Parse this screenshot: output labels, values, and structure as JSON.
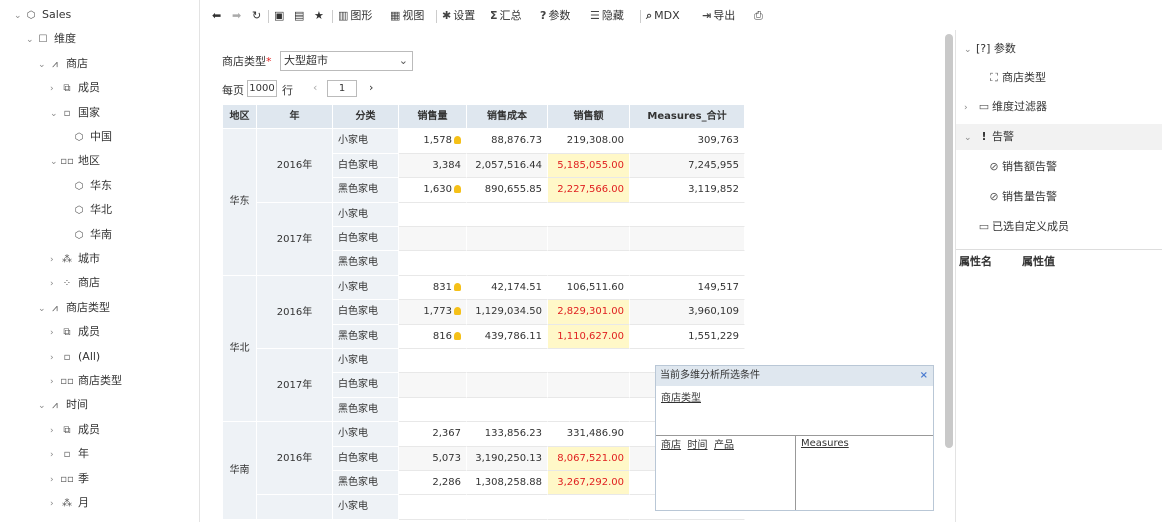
{
  "tree": {
    "root": "Sales",
    "items": [
      {
        "label": "Sales",
        "icon": "cube",
        "arrow": "v"
      },
      {
        "label": "维度",
        "icon": "dimension",
        "arrow": "v"
      },
      {
        "label": "商店",
        "icon": "hierarchy",
        "arrow": "v"
      },
      {
        "label": "成员",
        "icon": "member",
        "arrow": ">"
      },
      {
        "label": "国家",
        "icon": "level1",
        "arrow": "v"
      },
      {
        "label": "中国",
        "icon": "cube",
        "arrow": ""
      },
      {
        "label": "地区",
        "icon": "level2",
        "arrow": "v"
      },
      {
        "label": "华东",
        "icon": "cube",
        "arrow": ""
      },
      {
        "label": "华北",
        "icon": "cube",
        "arrow": ""
      },
      {
        "label": "华南",
        "icon": "cube",
        "arrow": ""
      },
      {
        "label": "城市",
        "icon": "level3",
        "arrow": ">"
      },
      {
        "label": "商店",
        "icon": "level4",
        "arrow": ">"
      },
      {
        "label": "商店类型",
        "icon": "hierarchy",
        "arrow": "v"
      },
      {
        "label": "成员",
        "icon": "member",
        "arrow": ">"
      },
      {
        "label": "(All)",
        "icon": "level1",
        "arrow": ">"
      },
      {
        "label": "商店类型",
        "icon": "level2",
        "arrow": ">"
      },
      {
        "label": "时间",
        "icon": "hierarchy",
        "arrow": "v"
      },
      {
        "label": "成员",
        "icon": "member",
        "arrow": ">"
      },
      {
        "label": "年",
        "icon": "level1",
        "arrow": ">"
      },
      {
        "label": "季",
        "icon": "level2",
        "arrow": ">"
      },
      {
        "label": "月",
        "icon": "level3",
        "arrow": ">"
      }
    ]
  },
  "toolbar": {
    "chart": "图形",
    "view": "视图",
    "settings": "设置",
    "summary": "汇总",
    "params": "参数",
    "hide": "隐藏",
    "mdx": "MDX",
    "export": "导出"
  },
  "filter": {
    "label": "商店类型",
    "required": "*",
    "value": "大型超市"
  },
  "paging": {
    "per_page_label": "每页",
    "per_page": "1000",
    "rows_label": "行",
    "page": "1"
  },
  "grid": {
    "headers": [
      "地区",
      "年",
      "分类",
      "销售量",
      "销售成本",
      "销售额",
      "Measures_合计"
    ],
    "sort_indicator": "▼",
    "regions": [
      {
        "name": "华东",
        "years": [
          {
            "year": "2016年",
            "rows": [
              {
                "cat": "小家电",
                "qty": "1,578",
                "bulb": true,
                "cost": "88,876.73",
                "sales": "219,308.00",
                "hl": false,
                "total": "309,763"
              },
              {
                "cat": "白色家电",
                "qty": "3,384",
                "bulb": false,
                "cost": "2,057,516.44",
                "sales": "5,185,055.00",
                "hl": true,
                "total": "7,245,955"
              },
              {
                "cat": "黑色家电",
                "qty": "1,630",
                "bulb": true,
                "cost": "890,655.85",
                "sales": "2,227,566.00",
                "hl": true,
                "total": "3,119,852"
              }
            ]
          },
          {
            "year": "2017年",
            "rows": [
              {
                "cat": "小家电",
                "qty": "",
                "bulb": false,
                "cost": "",
                "sales": "",
                "hl": false,
                "total": ""
              },
              {
                "cat": "白色家电",
                "qty": "",
                "bulb": false,
                "cost": "",
                "sales": "",
                "hl": false,
                "total": ""
              },
              {
                "cat": "黑色家电",
                "qty": "",
                "bulb": false,
                "cost": "",
                "sales": "",
                "hl": false,
                "total": ""
              }
            ]
          }
        ]
      },
      {
        "name": "华北",
        "years": [
          {
            "year": "2016年",
            "rows": [
              {
                "cat": "小家电",
                "qty": "831",
                "bulb": true,
                "cost": "42,174.51",
                "sales": "106,511.60",
                "hl": false,
                "total": "149,517"
              },
              {
                "cat": "白色家电",
                "qty": "1,773",
                "bulb": true,
                "cost": "1,129,034.50",
                "sales": "2,829,301.00",
                "hl": true,
                "total": "3,960,109"
              },
              {
                "cat": "黑色家电",
                "qty": "816",
                "bulb": true,
                "cost": "439,786.11",
                "sales": "1,110,627.00",
                "hl": true,
                "total": "1,551,229"
              }
            ]
          },
          {
            "year": "2017年",
            "rows": [
              {
                "cat": "小家电",
                "qty": "",
                "bulb": false,
                "cost": "",
                "sales": "",
                "hl": false,
                "total": ""
              },
              {
                "cat": "白色家电",
                "qty": "",
                "bulb": false,
                "cost": "",
                "sales": "",
                "hl": false,
                "total": ""
              },
              {
                "cat": "黑色家电",
                "qty": "",
                "bulb": false,
                "cost": "",
                "sales": "",
                "hl": false,
                "total": ""
              }
            ]
          }
        ]
      },
      {
        "name": "华南",
        "years": [
          {
            "year": "2016年",
            "rows": [
              {
                "cat": "小家电",
                "qty": "2,367",
                "bulb": false,
                "cost": "133,856.23",
                "sales": "331,486.90",
                "hl": false,
                "total": ""
              },
              {
                "cat": "白色家电",
                "qty": "5,073",
                "bulb": false,
                "cost": "3,190,250.13",
                "sales": "8,067,521.00",
                "hl": true,
                "total": ""
              },
              {
                "cat": "黑色家电",
                "qty": "2,286",
                "bulb": false,
                "cost": "1,308,258.88",
                "sales": "3,267,292.00",
                "hl": true,
                "total": ""
              }
            ]
          },
          {
            "year": "",
            "rows": [
              {
                "cat": "小家电",
                "qty": "",
                "bulb": false,
                "cost": "",
                "sales": "",
                "hl": false,
                "total": ""
              }
            ]
          }
        ]
      }
    ]
  },
  "popup": {
    "title": "当前多维分析所选条件",
    "close": "×",
    "filter": "商店类型",
    "rows": [
      "商店",
      "时间",
      "产品"
    ],
    "cols": "Measures"
  },
  "right": {
    "params": "[?] 参数",
    "param_item": "商店类型",
    "dim_filter": "维度过滤器",
    "alert": "告警",
    "alert1": "销售额告警",
    "alert2": "销售量告警",
    "custom": "已选自定义成员",
    "prop_name": "属性名",
    "prop_value": "属性值"
  },
  "colors": {
    "header_bg": "#dfe7ef",
    "highlight_bg": "#fff8c8",
    "highlight_text": "#e02020",
    "bulb": "#f5c018"
  }
}
